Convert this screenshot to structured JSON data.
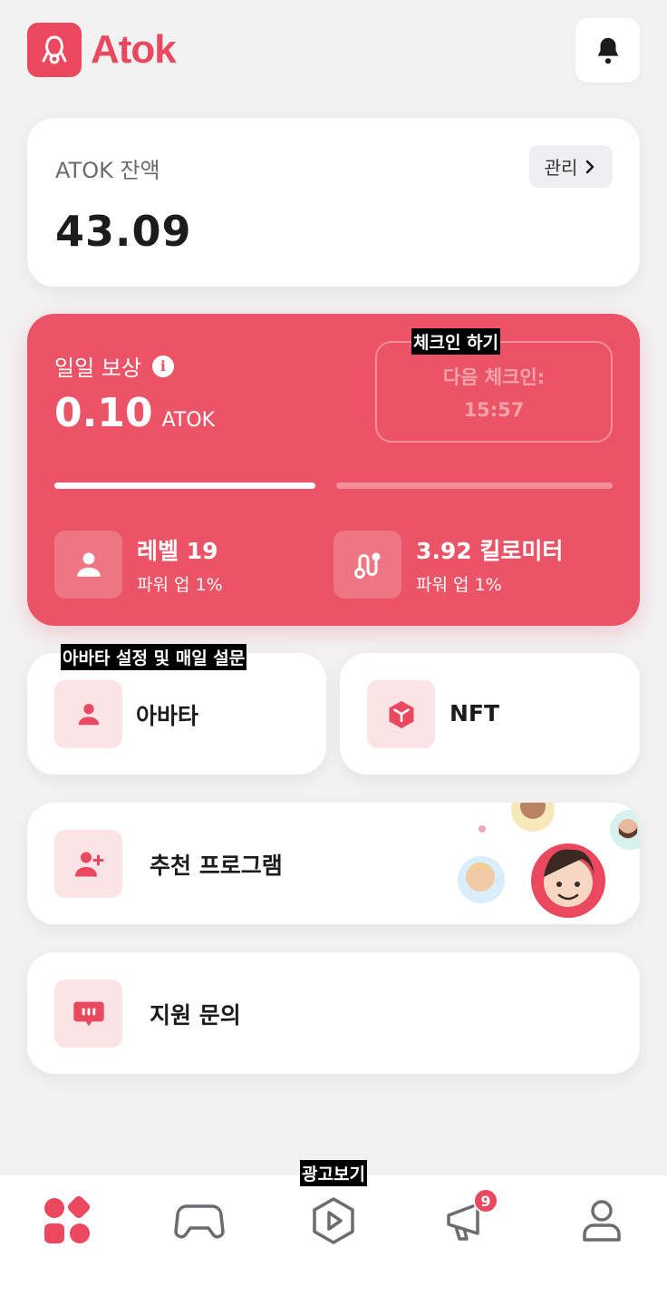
{
  "app": {
    "name": "Atok",
    "brand_color": "#e9485e"
  },
  "header": {
    "logo_text": "Atok",
    "notification_icon": "bell-icon"
  },
  "balance": {
    "label": "ATOK 잔액",
    "value": "43.09",
    "manage_label": "관리"
  },
  "daily_reward": {
    "label": "일일 보상",
    "amount": "0.10",
    "unit": "ATOK",
    "checkin_title": "체크인 하기",
    "next_checkin_label": "다음 체크인:",
    "next_checkin_time": "15:57",
    "level_title": "레벨 19",
    "level_sub": "파워 업 1%",
    "distance_title": "3.92 킬로미터",
    "distance_sub": "파워 업 1%"
  },
  "menu": {
    "avatar_caption": "아바타 설정 및 매일 설문",
    "avatar_label": "아바타",
    "nft_label": "NFT",
    "referral_label": "추천 프로그램",
    "support_label": "지원 문의"
  },
  "bottom_nav": {
    "ad_caption": "광고보기",
    "items": [
      "home-icon",
      "gamepad-icon",
      "play-icon",
      "megaphone-icon",
      "profile-icon"
    ],
    "badge_count": "9"
  }
}
